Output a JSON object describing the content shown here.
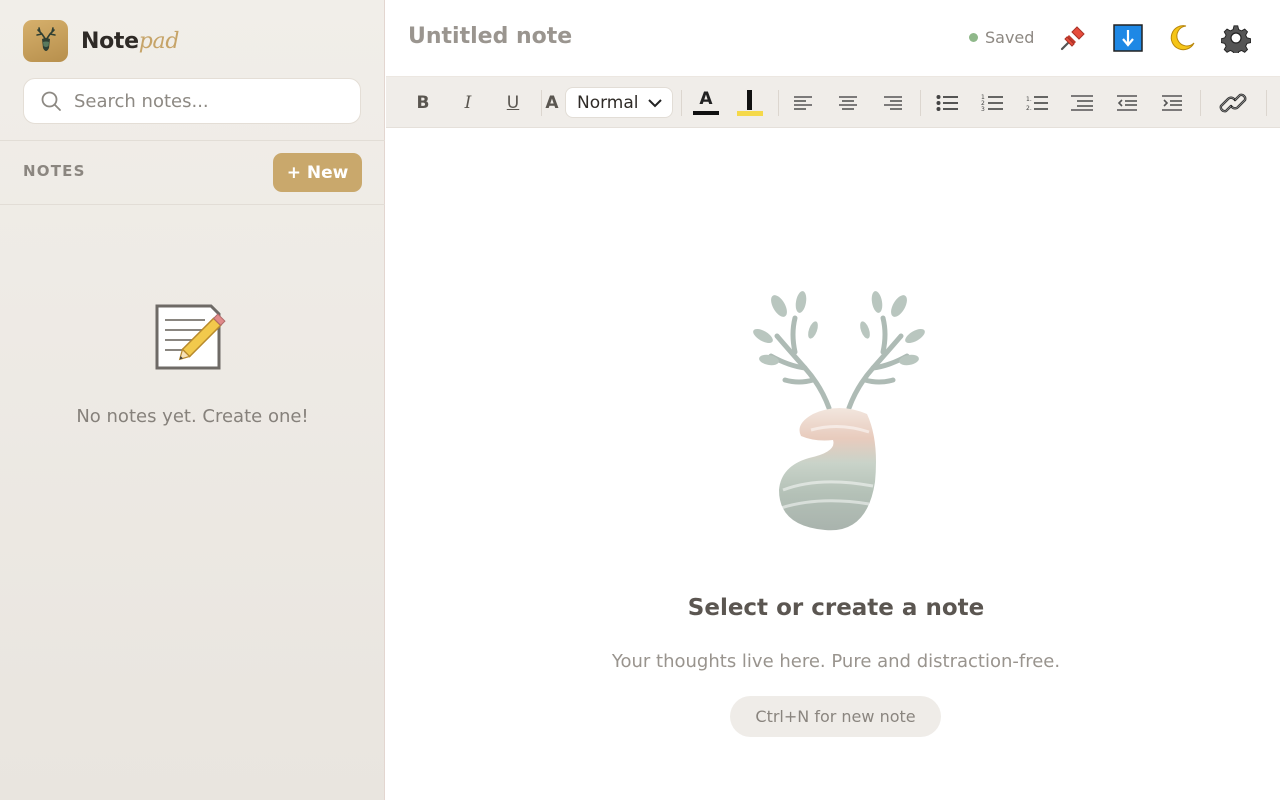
{
  "app": {
    "name": "Note",
    "name_accent": "pad"
  },
  "sidebar": {
    "search_placeholder": "Search notes...",
    "section_label": "NOTES",
    "new_button": "+ New",
    "empty_message": "No notes yet. Create one!"
  },
  "header": {
    "title_placeholder": "Untitled note",
    "status": "Saved",
    "status_color": "#8fb88a",
    "icons": [
      "pin-icon",
      "download-icon",
      "moon-icon",
      "gear-icon"
    ]
  },
  "toolbar": {
    "bold": "B",
    "italic": "I",
    "underline": "U",
    "font_size_glyph": "A",
    "format_select": "Normal",
    "text_color_glyph": "A",
    "text_color": "#111111",
    "highlight_color": "#f5d94a"
  },
  "main": {
    "empty_title": "Select or create a note",
    "empty_subtitle": "Your thoughts live here. Pure and distraction-free.",
    "shortcut_hint": "Ctrl+N for new note"
  },
  "colors": {
    "accent": "#c9a86c",
    "sidebar_bg": "#ece8e3"
  }
}
